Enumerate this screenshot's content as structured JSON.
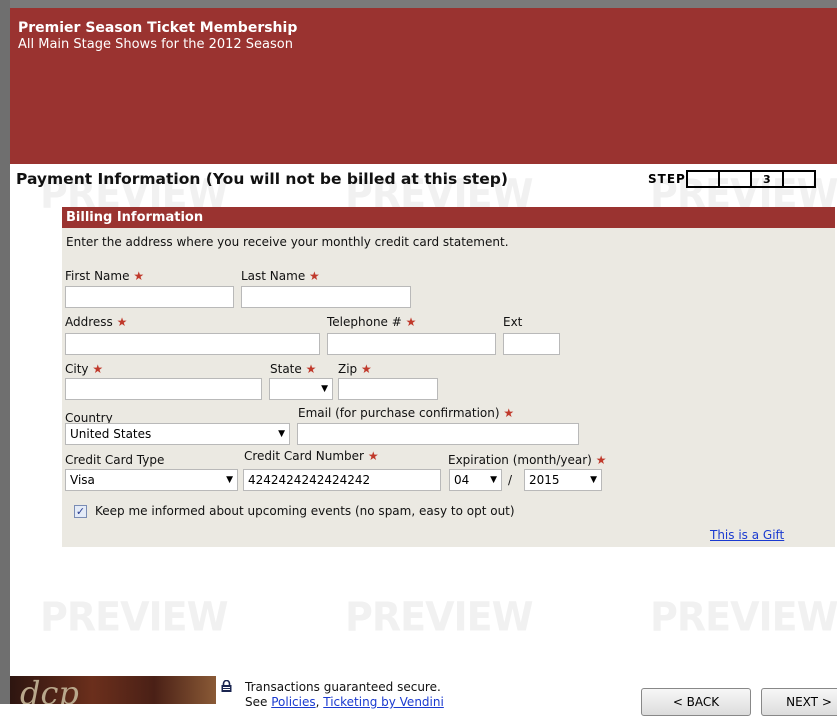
{
  "header": {
    "title": "Premier Season Ticket Membership",
    "subtitle": "All Main Stage Shows for the 2012 Season"
  },
  "watermark_text": "PREVIEW",
  "payment": {
    "title": "Payment Information (You will not be billed at this step)",
    "step_label": "STEP",
    "current_step": "3"
  },
  "billing": {
    "heading": "Billing Information",
    "description": "Enter the address where you receive your monthly credit card statement.",
    "first_name_label": "First Name",
    "last_name_label": "Last Name",
    "address_label": "Address",
    "telephone_label": "Telephone #",
    "ext_label": "Ext",
    "city_label": "City",
    "state_label": "State",
    "zip_label": "Zip",
    "country_label": "Country",
    "country_value": "United States",
    "email_label": "Email (for purchase confirmation)",
    "cc_type_label": "Credit Card Type",
    "cc_type_value": "Visa",
    "cc_number_label": "Credit Card Number",
    "cc_number_value": "4242424242424242",
    "expiration_label": "Expiration (month/year)",
    "exp_month": "04",
    "exp_sep": "/",
    "exp_year": "2015",
    "keep_informed_label": "Keep me informed about upcoming events (no spam, easy to opt out)",
    "keep_informed_checked": true,
    "gift_link": "This is a Gift",
    "required_mark": "★"
  },
  "footer": {
    "logo_text": "dcp",
    "secure_line1": "Transactions guaranteed secure.",
    "secure_line2_prefix": "See",
    "policies_link": "Policies",
    "ticketing_link": "Ticketing by Vendini",
    "back_button": "< BACK",
    "next_button": "NEXT >"
  },
  "colors": {
    "brand_red": "#9a3330",
    "panel_bg": "#ebe9e2",
    "link_blue": "#1a3ad0",
    "required_star": "#c0392b"
  }
}
